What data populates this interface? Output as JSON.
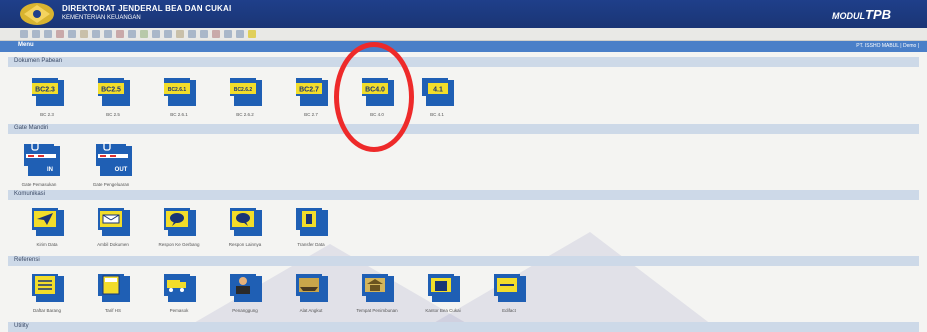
{
  "header": {
    "title": "DIREKTORAT JENDERAL BEA DAN CUKAI",
    "subtitle": "KEMENTERIAN KEUANGAN",
    "module_prefix": "MODUL",
    "module_name": "TPB"
  },
  "menubar": {
    "menu_label": "Menu",
    "user_label": "PT. ISSHO MABUL | Demo |"
  },
  "sections": [
    {
      "title": "Dokumen Pabean",
      "items": [
        {
          "label": "BC 2.3",
          "badge": "BC2.3"
        },
        {
          "label": "BC 2.5",
          "badge": "BC2.5"
        },
        {
          "label": "BC 2.6.1",
          "badge": "BC2.6.1"
        },
        {
          "label": "BC 2.6.2",
          "badge": "BC2.6.2"
        },
        {
          "label": "BC 2.7",
          "badge": "BC2.7"
        },
        {
          "label": "BC 4.0",
          "badge": "BC4.0"
        },
        {
          "label": "BC 4.1",
          "badge": "4.1"
        }
      ]
    },
    {
      "title": "Gate Mandiri",
      "items": [
        {
          "label": "Gate Pemasukan",
          "badge": "IN"
        },
        {
          "label": "Gate Pengeluaran",
          "badge": "OUT"
        }
      ]
    },
    {
      "title": "Komunikasi",
      "items": [
        {
          "label": "Kirim Data"
        },
        {
          "label": "Ambil Dokumen"
        },
        {
          "label": "Respon Ke Gerbang"
        },
        {
          "label": "Respon Lainnya"
        },
        {
          "label": "Transfer Data"
        }
      ]
    },
    {
      "title": "Referensi",
      "items": [
        {
          "label": "Daftar Barang"
        },
        {
          "label": "Tarif HS"
        },
        {
          "label": "Pemasok"
        },
        {
          "label": "Penanggung"
        },
        {
          "label": "Alat Angkut"
        },
        {
          "label": "Tempat Penimbunan"
        },
        {
          "label": "Kantor Bea Cukai"
        },
        {
          "label": "Edifact"
        }
      ]
    },
    {
      "title": "Utility"
    }
  ],
  "colors": {
    "header_bg": "#1f3f8a",
    "menubar_bg": "#4a7fc8",
    "folder_blue": "#1f5fb4",
    "label_yellow": "#f2dd2a",
    "annotation_red": "#ee2a2a"
  }
}
